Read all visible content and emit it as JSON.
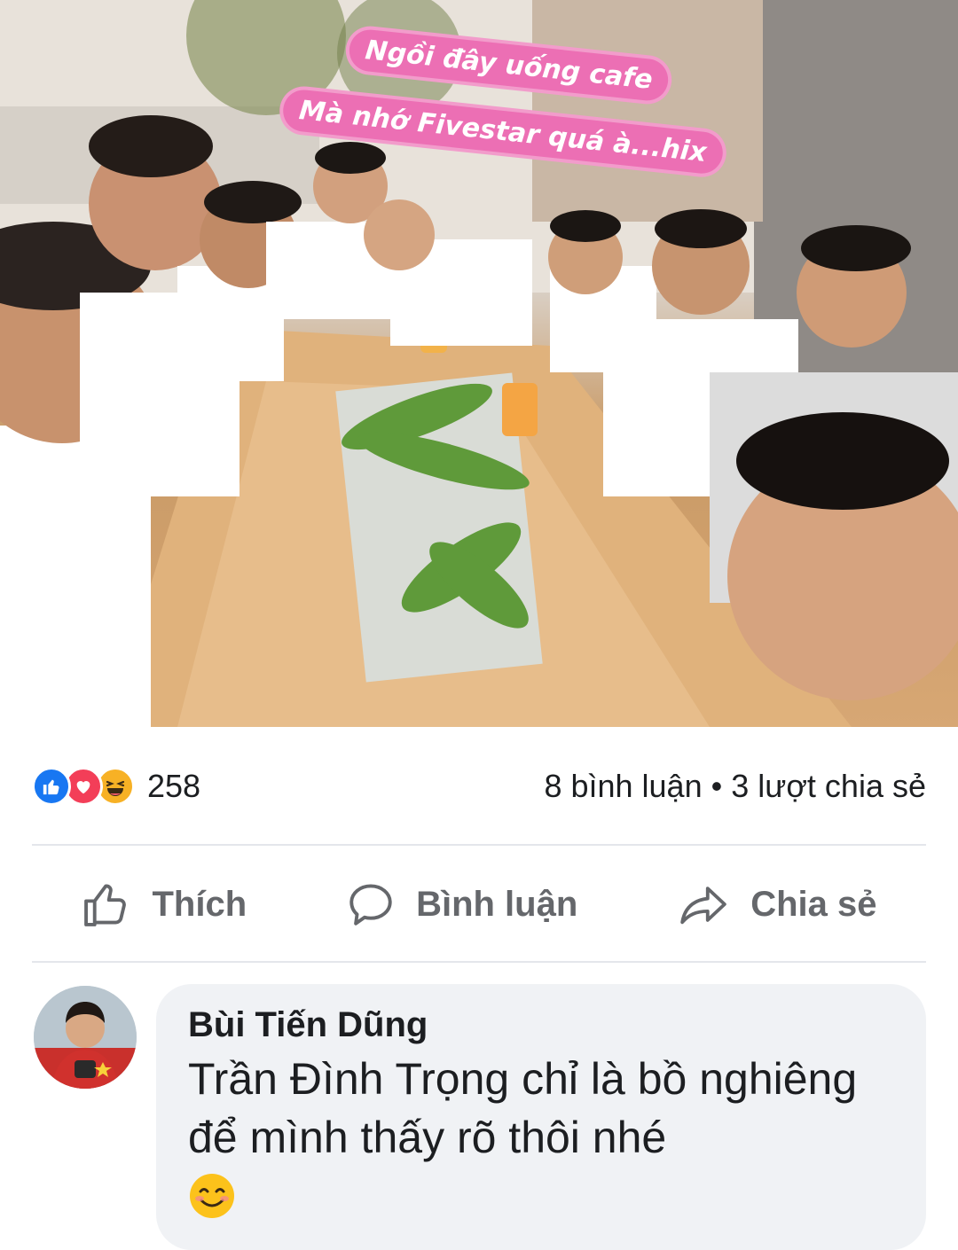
{
  "post": {
    "photo": {
      "caption_line1": "Ngồi đây uống cafe",
      "caption_line2": "Mà nhớ Fivestar quá à...hix"
    },
    "reactions": {
      "icons": [
        "like-icon",
        "love-icon",
        "haha-icon"
      ],
      "count": "258",
      "comments": "8 bình luận",
      "separator": "•",
      "shares": "3 lượt chia sẻ"
    },
    "actions": {
      "like_label": "Thích",
      "comment_label": "Bình luận",
      "share_label": "Chia sẻ"
    }
  },
  "comment": {
    "author": "Bùi Tiến Dũng",
    "text": "Trần Đình Trọng chỉ là bồ nghiêng để mình thấy rõ thôi nhé",
    "emoji": "smiling-face-icon"
  },
  "colors": {
    "like_blue": "#1877f2",
    "love_red": "#f33e58",
    "haha_yellow": "#f7b125",
    "caption_pink": "#ec6fb4",
    "action_gray": "#65676b",
    "bubble_gray": "#f0f2f5"
  }
}
